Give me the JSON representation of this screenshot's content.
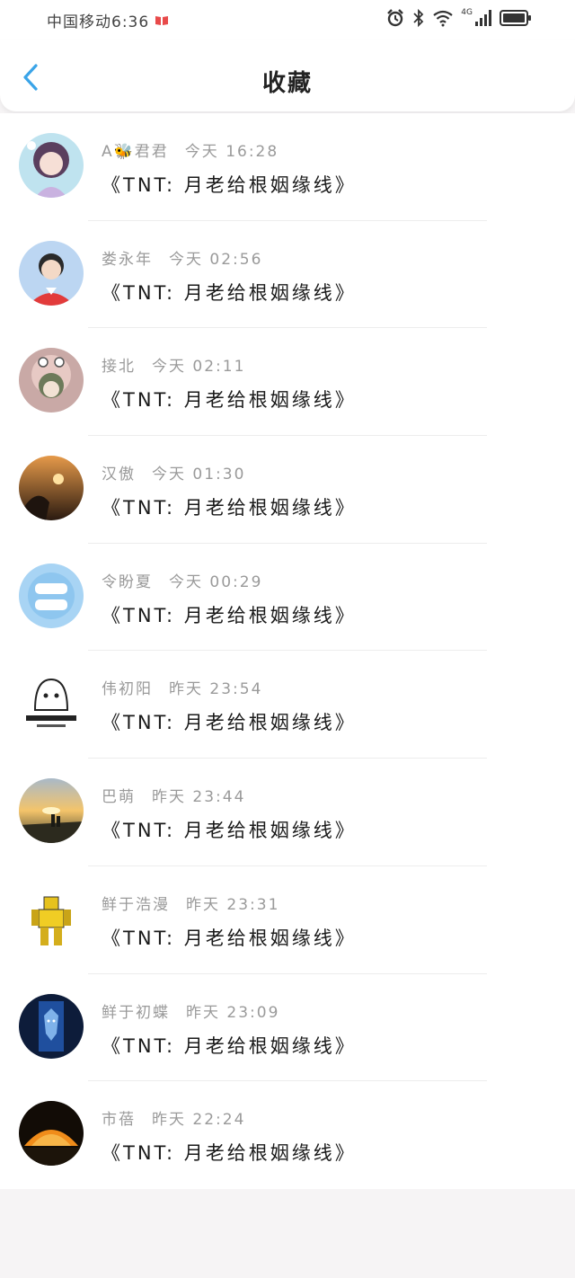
{
  "status_bar": {
    "carrier_time": "中国移动6:36",
    "network": "4G"
  },
  "header": {
    "title": "收藏"
  },
  "items": [
    {
      "user": "A🐝君君",
      "time": "今天 16:28",
      "title": "《TNT: 月老给根姻缘线》",
      "avatar": "anime-girl-avatar"
    },
    {
      "user": "娄永年",
      "time": "今天 02:56",
      "title": "《TNT: 月老给根姻缘线》",
      "avatar": "boy-red-shirt-avatar"
    },
    {
      "user": "接北",
      "time": "今天 02:11",
      "title": "《TNT: 月老给根姻缘线》",
      "avatar": "cartoon-hood-avatar"
    },
    {
      "user": "汉傲",
      "time": "今天 01:30",
      "title": "《TNT: 月老给根姻缘线》",
      "avatar": "sunset-dog-avatar"
    },
    {
      "user": "令盼夏",
      "time": "今天 00:29",
      "title": "《TNT: 月老给根姻缘线》",
      "avatar": "blue-badge-avatar"
    },
    {
      "user": "伟初阳",
      "time": "昨天 23:54",
      "title": "《TNT: 月老给根姻缘线》",
      "avatar": "meme-avatar"
    },
    {
      "user": "巴萌",
      "time": "昨天 23:44",
      "title": "《TNT: 月老给根姻缘线》",
      "avatar": "sunset-couple-avatar"
    },
    {
      "user": "鲜于浩漫",
      "time": "昨天 23:31",
      "title": "《TNT: 月老给根姻缘线》",
      "avatar": "robot-avatar"
    },
    {
      "user": "鲜于初蝶",
      "time": "昨天 23:09",
      "title": "《TNT: 月老给根姻缘线》",
      "avatar": "wolf-avatar"
    },
    {
      "user": "市蓓",
      "time": "昨天 22:24",
      "title": "《TNT: 月老给根姻缘线》",
      "avatar": "orange-tent-avatar"
    }
  ],
  "colors": {
    "accent": "#3aa4e8",
    "meta_text": "#9a9a9a",
    "background": "#f6f4f5"
  }
}
